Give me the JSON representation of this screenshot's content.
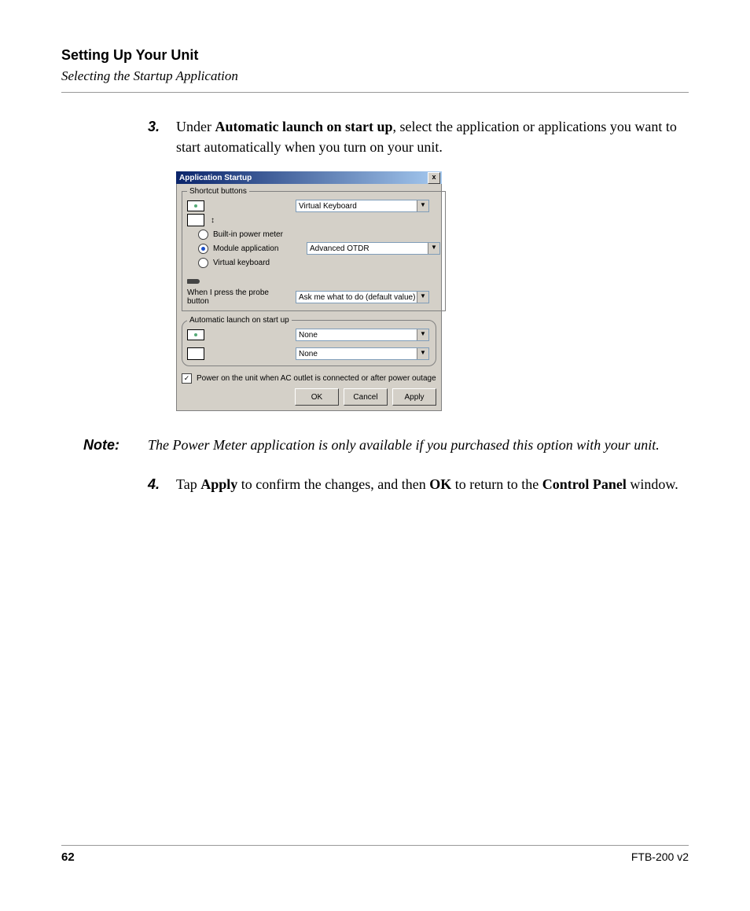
{
  "header": {
    "chapter": "Setting Up Your Unit",
    "section": "Selecting the Startup Application"
  },
  "steps": {
    "s3": {
      "num": "3.",
      "pre": "Under ",
      "bold1": "Automatic launch on start up",
      "post": ", select the application or applications you want to start automatically when you turn on your unit."
    },
    "s4": {
      "num": "4.",
      "t1": "Tap ",
      "b1": "Apply",
      "t2": " to confirm the changes, and then ",
      "b2": "OK",
      "t3": " to return to the ",
      "b3": "Control Panel",
      "t4": " window."
    }
  },
  "note": {
    "label": "Note:",
    "text": "The Power Meter application is only available if you purchased this option with your unit."
  },
  "dialog": {
    "title": "Application Startup",
    "close": "x",
    "group1_legend": "Shortcut buttons",
    "combo1": "Virtual Keyboard",
    "radio_builtin": "Built-in power meter",
    "radio_module": "Module application",
    "radio_vk": "Virtual keyboard",
    "combo2": "Advanced OTDR",
    "probe_label": "When I press the probe button",
    "combo3": "Ask me what to do  (default value)",
    "group2_legend": "Automatic launch on start up",
    "combo4": "None",
    "combo5": "None",
    "checkbox_mark": "✓",
    "checkbox_label": "Power on the unit when AC outlet is connected or after power outage",
    "btn_ok": "OK",
    "btn_cancel": "Cancel",
    "btn_apply": "Apply"
  },
  "footer": {
    "page": "62",
    "docid": "FTB-200 v2"
  }
}
